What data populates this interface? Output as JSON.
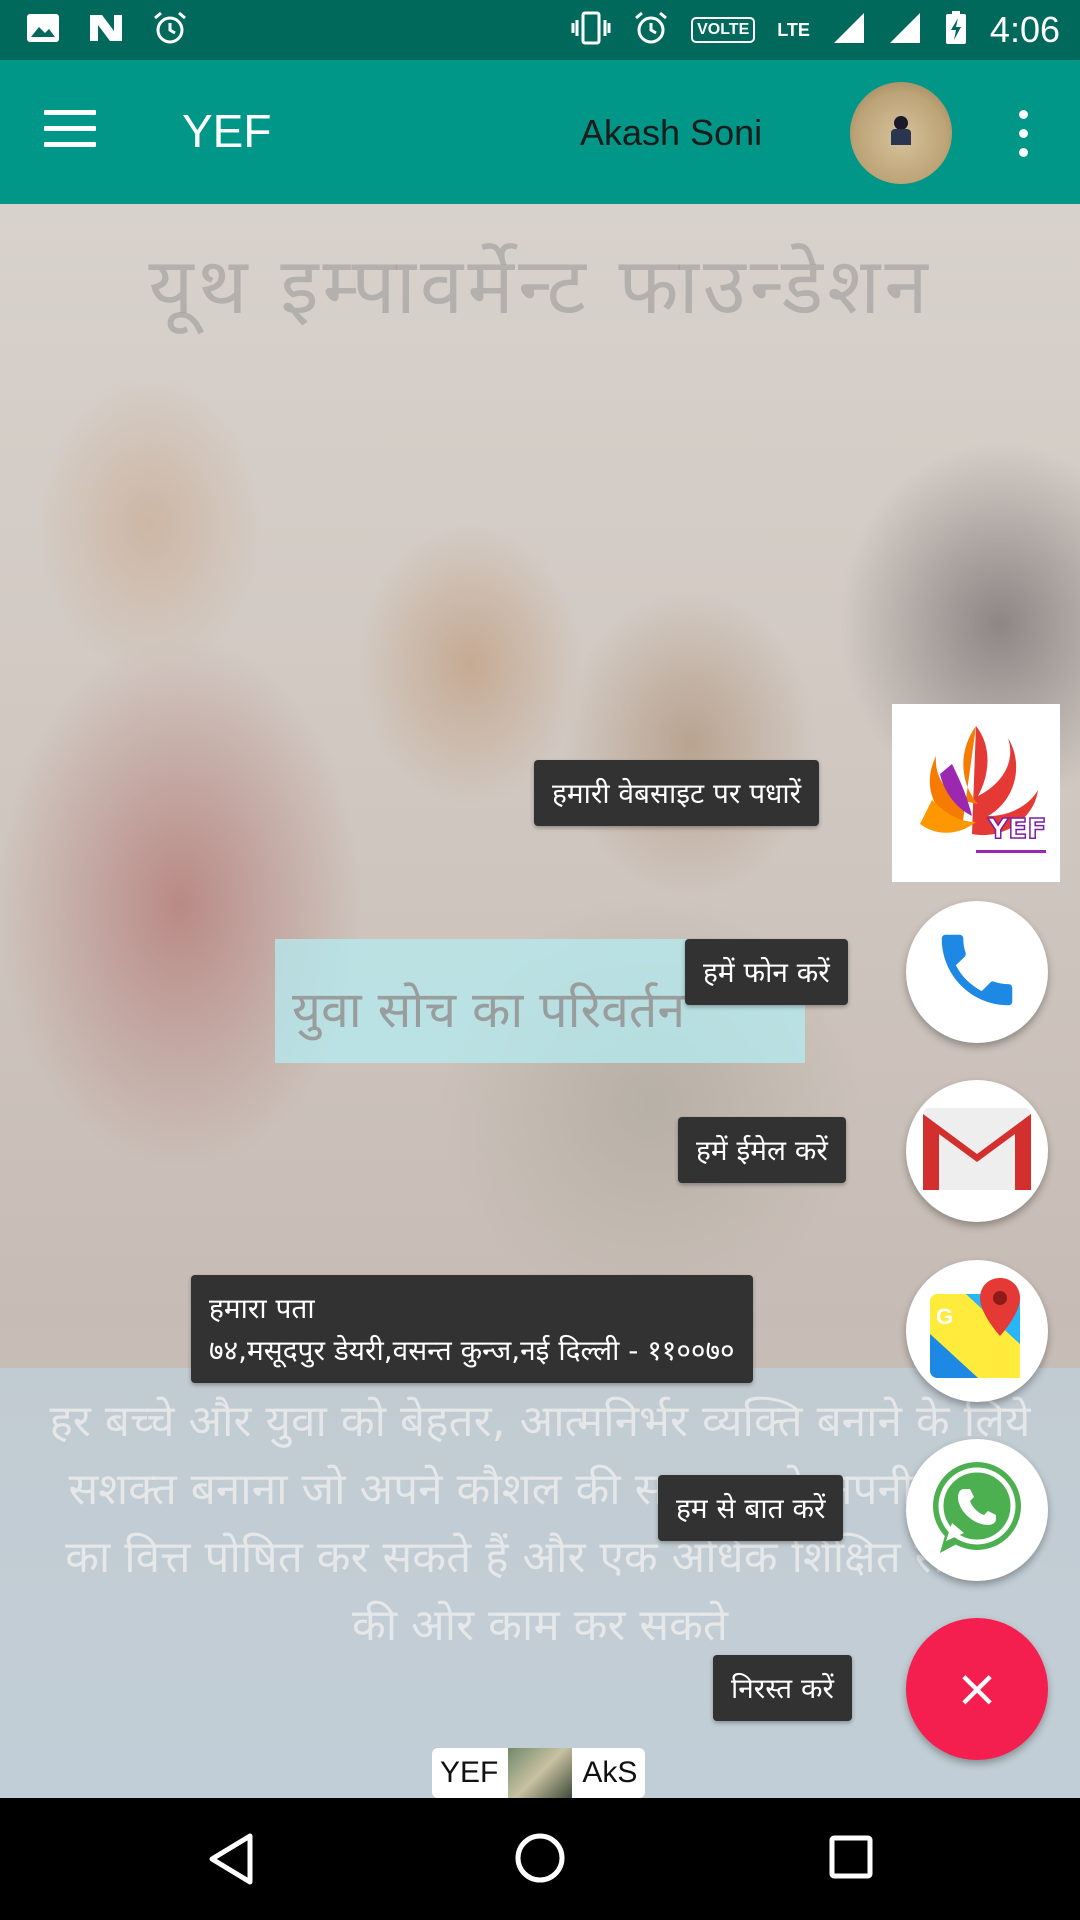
{
  "status_bar": {
    "time": "4:06",
    "volte": "VOLTE",
    "lte": "LTE",
    "icons": [
      "image-icon",
      "n-icon",
      "alarm-icon",
      "vibrate-icon",
      "alarm-icon",
      "signal-icon",
      "signal-icon",
      "battery-charging-icon"
    ]
  },
  "app_bar": {
    "title": "YEF",
    "user_name": "Akash Soni",
    "icons": [
      "menu-icon",
      "avatar",
      "overflow-menu-icon"
    ]
  },
  "background": {
    "heading": "यूथ  इम्पावर्मेन्ट  फाउन्डेशन",
    "tagline": "युवा सोच का परिवर्तन",
    "description": "हर बच्चे और युवा को बेहतर, आत्मनिर्भर व्यक्ति बनाने के लिये सशक्त बनाना जो अपने कौशल की सहायता से अपनी शिक्षा का वित्त पोषित कर सकते हैं और एक अधिक शिक्षित समाज की ओर काम कर सकते"
  },
  "speed_dial": {
    "website_label": "हमारी वेबसाइट पर पधारें",
    "website_logo_text": "YEF",
    "phone_label": "हमें फोन करें",
    "email_label": "हमें ईमेल करें",
    "address_title": "हमारा पता",
    "address_line": "७४,मसूदपुर डेयरी,वसन्त कुन्ज,नई दिल्ली - ११००७०",
    "whatsapp_label": "हम से बात करें",
    "dismiss_label": "निरस्त करें",
    "close_symbol": "×"
  },
  "credit": {
    "left": "YEF",
    "right": "AkS"
  },
  "colors": {
    "status_bar": "#00695c",
    "app_bar": "#009688",
    "fab_main": "#f41f4e",
    "phone_blue": "#1e88e5",
    "gmail_red": "#d32f2f",
    "whatsapp_green": "#4caf50"
  },
  "nav_bar": {
    "icons": [
      "back-icon",
      "home-icon",
      "recents-icon"
    ]
  }
}
